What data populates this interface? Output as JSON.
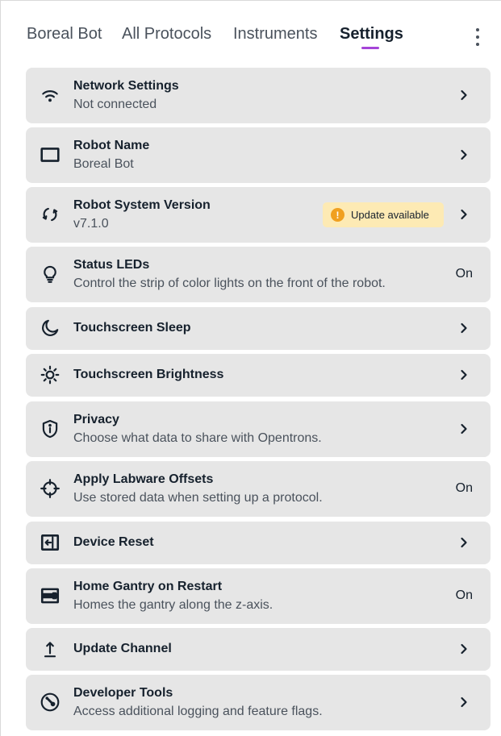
{
  "tabs": [
    {
      "label": "Boreal Bot",
      "active": false
    },
    {
      "label": "All Protocols",
      "active": false
    },
    {
      "label": "Instruments",
      "active": false
    },
    {
      "label": "Settings",
      "active": true
    }
  ],
  "more_menu_icon": "more-vertical-icon",
  "accent_color": "#a544d8",
  "settings": [
    {
      "icon": "wifi-icon",
      "title": "Network Settings",
      "subtitle": "Not connected",
      "action": "chevron"
    },
    {
      "icon": "monitor-icon",
      "title": "Robot Name",
      "subtitle": "Boreal Bot",
      "action": "chevron"
    },
    {
      "icon": "refresh-icon",
      "title": "Robot System Version",
      "subtitle": "v7.1.0",
      "action": "chevron",
      "badge": "Update available",
      "badge_icon": "alert-circle-icon"
    },
    {
      "icon": "light-bulb-icon",
      "title": "Status LEDs",
      "subtitle": "Control the strip of color lights on the front of the robot.",
      "action": "state",
      "state": "On"
    },
    {
      "icon": "moon-icon",
      "title": "Touchscreen Sleep",
      "subtitle": "",
      "action": "chevron"
    },
    {
      "icon": "sun-icon",
      "title": "Touchscreen Brightness",
      "subtitle": "",
      "action": "chevron"
    },
    {
      "icon": "shield-info-icon",
      "title": "Privacy",
      "subtitle": "Choose what data to share with Opentrons.",
      "action": "chevron"
    },
    {
      "icon": "crosshair-icon",
      "title": "Apply Labware Offsets",
      "subtitle": "Use stored data when setting up a protocol.",
      "action": "state",
      "state": "On"
    },
    {
      "icon": "device-reset-icon",
      "title": "Device Reset",
      "subtitle": "",
      "action": "chevron"
    },
    {
      "icon": "gantry-icon",
      "title": "Home Gantry on Restart",
      "subtitle": "Homes the gantry along the z-axis.",
      "action": "state",
      "state": "On"
    },
    {
      "icon": "upload-icon",
      "title": "Update Channel",
      "subtitle": "",
      "action": "chevron"
    },
    {
      "icon": "wrench-icon",
      "title": "Developer Tools",
      "subtitle": "Access additional logging and feature flags.",
      "action": "chevron"
    }
  ]
}
